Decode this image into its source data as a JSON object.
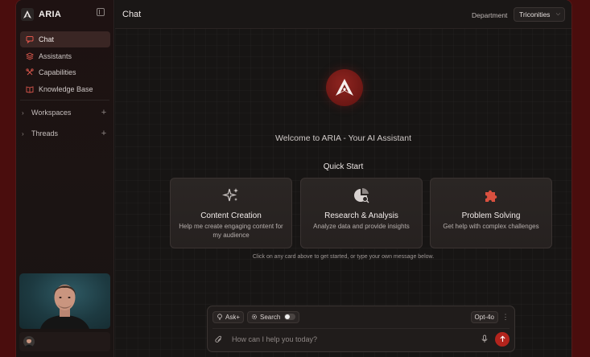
{
  "brand": {
    "name": "ARIA"
  },
  "sidebar": {
    "items": [
      {
        "label": "Chat",
        "icon": "chat-icon",
        "active": true
      },
      {
        "label": "Assistants",
        "icon": "layers-icon",
        "active": false
      },
      {
        "label": "Capabilities",
        "icon": "tools-icon",
        "active": false
      },
      {
        "label": "Knowledge Base",
        "icon": "book-icon",
        "active": false
      }
    ],
    "groups": [
      {
        "label": "Workspaces"
      },
      {
        "label": "Threads"
      }
    ]
  },
  "header": {
    "title": "Chat",
    "department_label": "Department",
    "department_value": "Triconities"
  },
  "main": {
    "welcome": "Welcome to ARIA - Your AI Assistant",
    "quick_start": "Quick Start",
    "cards": [
      {
        "title": "Content Creation",
        "description": "Help me create engaging content for my audience",
        "icon": "sparkles-icon"
      },
      {
        "title": "Research & Analysis",
        "description": "Analyze data and provide insights",
        "icon": "chart-search-icon"
      },
      {
        "title": "Problem Solving",
        "description": "Get help with complex challenges",
        "icon": "puzzle-icon"
      }
    ],
    "hint": "Click on any card above to get started, or type your own message below."
  },
  "composer": {
    "ask_label": "Ask+",
    "search_label": "Search",
    "search_enabled": false,
    "model": "Opt-4o",
    "placeholder": "How can I help you today?"
  },
  "colors": {
    "accent": "#b3241d",
    "background": "#171514",
    "outer": "#4a0d0d"
  }
}
